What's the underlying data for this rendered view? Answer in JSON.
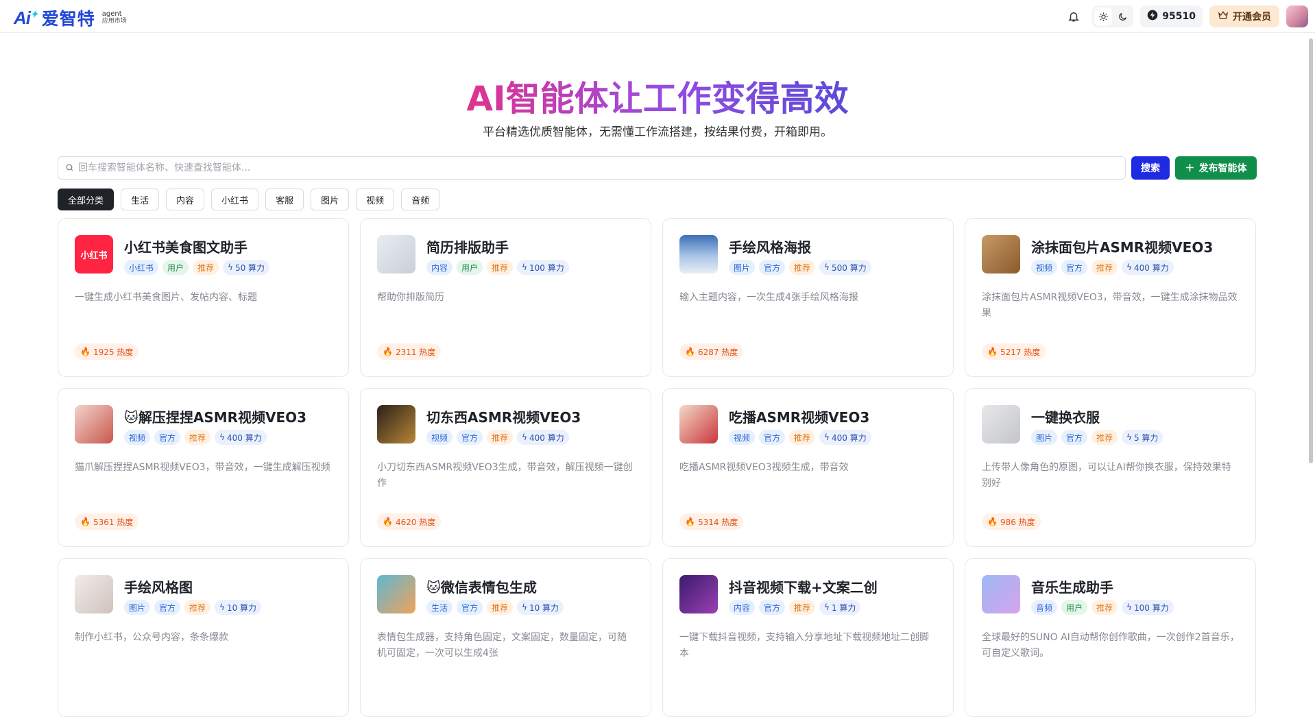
{
  "header": {
    "brand_ai": "Ai",
    "brand_name": "爱智特",
    "brand_sub_1": "agent",
    "brand_sub_2": "应用市场",
    "credits": "95510",
    "vip_label": "开通会员"
  },
  "hero": {
    "title": "AI智能体让工作变得高效",
    "subtitle": "平台精选优质智能体，无需懂工作流搭建，按结果付费，开箱即用。"
  },
  "search": {
    "placeholder": "回车搜索智能体名称、快速查找智能体...",
    "value": "",
    "search_label": "搜索",
    "publish_label": "发布智能体"
  },
  "categories": [
    "全部分类",
    "生活",
    "内容",
    "小红书",
    "客服",
    "图片",
    "视频",
    "音频"
  ],
  "cards": [
    {
      "title": "小红书美食图文助手",
      "tags": [
        "小红书",
        "用户",
        "推荐"
      ],
      "power": "50 算力",
      "desc": "一键生成小红书美食图片、发帖内容、标题",
      "heat": "1925 热度",
      "thumb_text": "小红书"
    },
    {
      "title": "简历排版助手",
      "tags": [
        "内容",
        "用户",
        "推荐"
      ],
      "power": "100 算力",
      "desc": "帮助你排版简历",
      "heat": "2311 热度",
      "thumb_text": ""
    },
    {
      "title": "手绘风格海报",
      "tags": [
        "图片",
        "官方",
        "推荐"
      ],
      "power": "500 算力",
      "desc": "输入主题内容，一次生成4张手绘风格海报",
      "heat": "6287 热度",
      "thumb_text": ""
    },
    {
      "title": "涂抹面包片ASMR视频VEO3",
      "tags": [
        "视频",
        "官方",
        "推荐"
      ],
      "power": "400 算力",
      "desc": "涂抹面包片ASMR视频VEO3，带音效，一键生成涂抹物品效果",
      "heat": "5217 热度",
      "thumb_text": ""
    },
    {
      "title": "🐱解压捏捏ASMR视频VEO3",
      "tags": [
        "视频",
        "官方",
        "推荐"
      ],
      "power": "400 算力",
      "desc": "猫爪解压捏捏ASMR视频VEO3，带音效，一键生成解压视频",
      "heat": "5361 热度",
      "thumb_text": ""
    },
    {
      "title": "切东西ASMR视频VEO3",
      "tags": [
        "视频",
        "官方",
        "推荐"
      ],
      "power": "400 算力",
      "desc": "小刀切东西ASMR视频VEO3生成，带音效，解压视频一键创作",
      "heat": "4620 热度",
      "thumb_text": ""
    },
    {
      "title": "吃播ASMR视频VEO3",
      "tags": [
        "视频",
        "官方",
        "推荐"
      ],
      "power": "400 算力",
      "desc": "吃播ASMR视频VEO3视频生成，带音效",
      "heat": "5314 热度",
      "thumb_text": ""
    },
    {
      "title": "一键换衣服",
      "tags": [
        "图片",
        "官方",
        "推荐"
      ],
      "power": "5 算力",
      "desc": "上传带人像角色的原图，可以让AI帮你换衣服，保持效果特别好",
      "heat": "986 热度",
      "thumb_text": ""
    },
    {
      "title": "手绘风格图",
      "tags": [
        "图片",
        "官方",
        "推荐"
      ],
      "power": "10 算力",
      "desc": "制作小红书，公众号内容，条条爆款",
      "heat": "",
      "thumb_text": ""
    },
    {
      "title": "🐱微信表情包生成",
      "tags": [
        "生活",
        "官方",
        "推荐"
      ],
      "power": "10 算力",
      "desc": "表情包生成器，支持角色固定，文案固定，数量固定，可随机可固定，一次可以生成4张",
      "heat": "",
      "thumb_text": ""
    },
    {
      "title": "抖音视频下载+文案二创",
      "tags": [
        "内容",
        "官方",
        "推荐"
      ],
      "power": "1 算力",
      "desc": "一键下载抖音视频，支持输入分享地址下载视频地址二创脚本",
      "heat": "",
      "thumb_text": ""
    },
    {
      "title": "音乐生成助手",
      "tags": [
        "音频",
        "用户",
        "推荐"
      ],
      "power": "100 算力",
      "desc": "全球最好的SUNO AI自动帮你创作歌曲，一次创作2首音乐，可自定义歌词。",
      "heat": "",
      "thumb_text": ""
    }
  ],
  "colors": {
    "primary": "#1f2be0",
    "publish": "#0f8f4a",
    "brand": "#2347d6"
  }
}
